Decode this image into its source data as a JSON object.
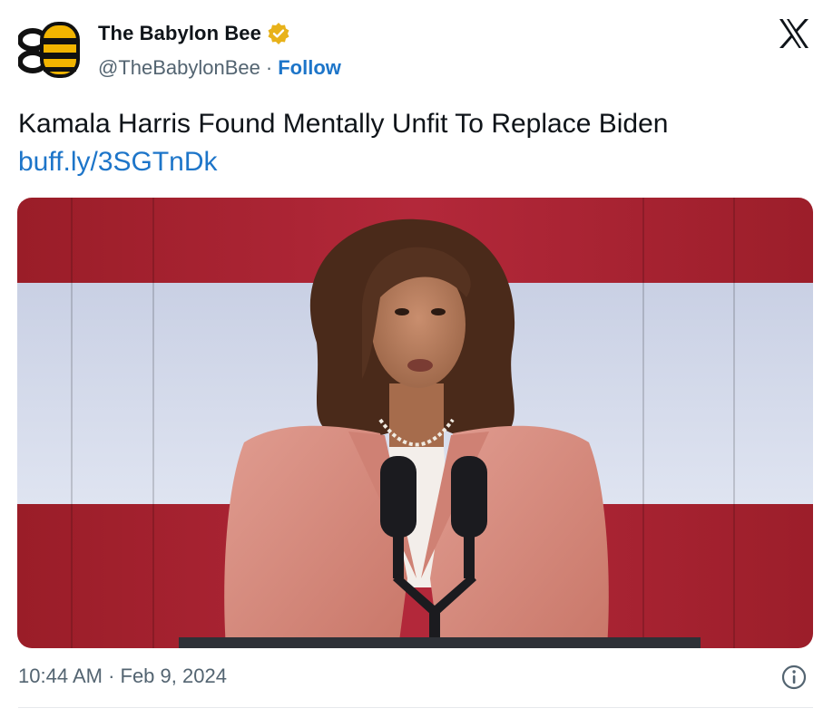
{
  "account": {
    "display_name": "The Babylon Bee",
    "handle": "@TheBabylonBee",
    "separator": "·",
    "follow_label": "Follow",
    "verified_color": "#e8b21a",
    "avatar_icon": "bee-logo-icon"
  },
  "tweet": {
    "text": "Kamala Harris Found Mentally Unfit To Replace Biden",
    "link": "buff.ly/3SGTnDk",
    "timestamp": "10:44 AM · Feb 9, 2024"
  },
  "media": {
    "icon": "photo-woman-speaking-at-podium"
  },
  "colors": {
    "link": "#1d75c9",
    "secondary_text": "#536471",
    "flag_red": "#a31f2c",
    "flag_white": "#d4dbea",
    "jacket": "#d88a80"
  }
}
